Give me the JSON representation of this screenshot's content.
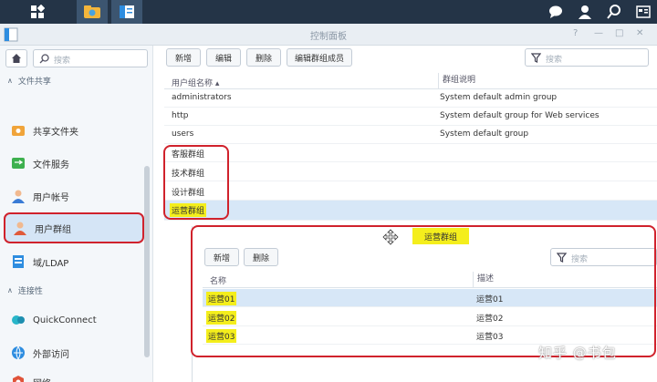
{
  "window": {
    "title": "控制面板",
    "controls": [
      "?",
      "—",
      "□",
      "✕"
    ]
  },
  "sidebar": {
    "search_placeholder": "搜索",
    "section_file_sharing": "文件共享",
    "section_connectivity": "连接性",
    "items": [
      {
        "label": "共享文件夹",
        "icon": "shared-folder-icon"
      },
      {
        "label": "文件服务",
        "icon": "file-services-icon"
      },
      {
        "label": "用户帐号",
        "icon": "user-icon"
      },
      {
        "label": "用户群组",
        "icon": "user-group-icon"
      },
      {
        "label": "域/LDAP",
        "icon": "domain-ldap-icon"
      },
      {
        "label": "QuickConnect",
        "icon": "quickconnect-icon"
      },
      {
        "label": "外部访问",
        "icon": "external-access-icon"
      },
      {
        "label": "网络",
        "icon": "network-icon"
      }
    ]
  },
  "toolbar": {
    "create": "新增",
    "edit": "编辑",
    "delete": "删除",
    "edit_members": "编辑群组成员",
    "search_placeholder": "搜索"
  },
  "group_table": {
    "columns": [
      "用户组名称 ▴",
      "群组说明"
    ],
    "rows": [
      {
        "name": "administrators",
        "description": "System default admin group"
      },
      {
        "name": "http",
        "description": "System default group for Web services"
      },
      {
        "name": "users",
        "description": "System default group"
      },
      {
        "name": "客服群组",
        "description": ""
      },
      {
        "name": "技术群组",
        "description": ""
      },
      {
        "name": "设计群组",
        "description": ""
      },
      {
        "name": "运营群组",
        "description": ""
      }
    ]
  },
  "popup": {
    "title": "运营群组",
    "create": "新增",
    "delete": "删除",
    "search_placeholder": "搜索",
    "columns": [
      "名称",
      "描述"
    ],
    "rows": [
      {
        "name": "运营01",
        "description": "运营01"
      },
      {
        "name": "运营02",
        "description": "运营02"
      },
      {
        "name": "运营03",
        "description": "运营03"
      }
    ]
  },
  "watermark": "知乎 @书包",
  "colors": {
    "taskbar": "#243447",
    "highlight": "#f4ee1c",
    "annotation": "#d0222c",
    "selected_row": "#d7e7f7"
  }
}
